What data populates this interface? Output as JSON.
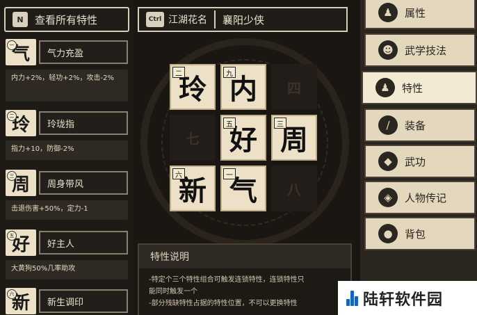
{
  "left": {
    "header": {
      "key": "N",
      "label": "查看所有特性"
    },
    "traits": [
      {
        "glyph": "气",
        "num": "一",
        "name": "气力充盈",
        "desc": "内力+2%，轻功+2%，攻击-2%"
      },
      {
        "glyph": "玲",
        "num": "二",
        "name": "玲珑指",
        "desc": "指力+10，防御-2%"
      },
      {
        "glyph": "周",
        "num": "三",
        "name": "周身带风",
        "desc": "击退伤害+50%，定力-1"
      },
      {
        "glyph": "好",
        "num": "五",
        "name": "好主人",
        "desc": "大黄狗50%几率助攻"
      },
      {
        "glyph": "新",
        "num": "六",
        "name": "新生调印",
        "desc": ""
      }
    ]
  },
  "mid": {
    "ctrl_key": "Ctrl",
    "tag": "江湖花名",
    "nickname": "襄阳少侠",
    "grid": [
      {
        "glyph": "玲",
        "num": "二",
        "active": true
      },
      {
        "glyph": "内",
        "num": "九",
        "active": true
      },
      {
        "glyph": "四",
        "num": "",
        "active": false
      },
      {
        "glyph": "七",
        "num": "",
        "active": false
      },
      {
        "glyph": "好",
        "num": "五",
        "active": true
      },
      {
        "glyph": "周",
        "num": "三",
        "active": true
      },
      {
        "glyph": "新",
        "num": "六",
        "active": true
      },
      {
        "glyph": "气",
        "num": "一",
        "active": true
      },
      {
        "glyph": "八",
        "num": "",
        "active": false
      }
    ],
    "info": {
      "title": "特性说明",
      "lines": [
        "-特定个三个特性组合可触发连锁特性，连锁特性只",
        "能同时触发一个",
        "-部分残缺特性占据的特性位置，不可以更换特性"
      ]
    }
  },
  "tabs": [
    {
      "icon": "♟",
      "label": "属性",
      "active": false
    },
    {
      "icon": "☻",
      "label": "武学技法",
      "active": false
    },
    {
      "icon": "♟",
      "label": "特性",
      "active": true
    },
    {
      "icon": "/",
      "label": "装备",
      "active": false
    },
    {
      "icon": "◆",
      "label": "武功",
      "active": false
    },
    {
      "icon": "◈",
      "label": "人物传记",
      "active": false
    },
    {
      "icon": "●",
      "label": "背包",
      "active": false
    }
  ],
  "watermark": {
    "text": "陆轩软件园"
  }
}
